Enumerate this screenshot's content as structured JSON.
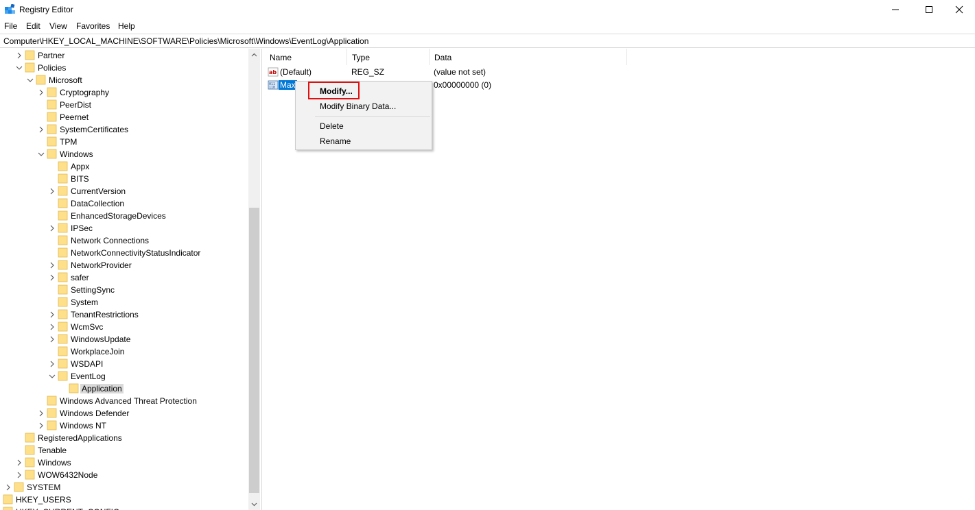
{
  "window": {
    "title": "Registry Editor",
    "minimize_glyph": "—",
    "maximize_glyph": "☐",
    "close_glyph": "✕"
  },
  "menu": [
    "File",
    "Edit",
    "View",
    "Favorites",
    "Help"
  ],
  "address": {
    "path": "Computer\\HKEY_LOCAL_MACHINE\\SOFTWARE\\Policies\\Microsoft\\Windows\\EventLog\\Application"
  },
  "tree": [
    {
      "label": "Partner",
      "expander": "collapsed"
    },
    {
      "label": "Policies",
      "expander": "expanded"
    },
    {
      "label": "Microsoft",
      "expander": "expanded"
    },
    {
      "label": "Cryptography",
      "expander": "collapsed"
    },
    {
      "label": "PeerDist",
      "expander": "none"
    },
    {
      "label": "Peernet",
      "expander": "none"
    },
    {
      "label": "SystemCertificates",
      "expander": "collapsed"
    },
    {
      "label": "TPM",
      "expander": "none"
    },
    {
      "label": "Windows",
      "expander": "expanded"
    },
    {
      "label": "Appx",
      "expander": "none"
    },
    {
      "label": "BITS",
      "expander": "none"
    },
    {
      "label": "CurrentVersion",
      "expander": "collapsed"
    },
    {
      "label": "DataCollection",
      "expander": "none"
    },
    {
      "label": "EnhancedStorageDevices",
      "expander": "none"
    },
    {
      "label": "IPSec",
      "expander": "collapsed"
    },
    {
      "label": "Network Connections",
      "expander": "none"
    },
    {
      "label": "NetworkConnectivityStatusIndicator",
      "expander": "none"
    },
    {
      "label": "NetworkProvider",
      "expander": "collapsed"
    },
    {
      "label": "safer",
      "expander": "collapsed"
    },
    {
      "label": "SettingSync",
      "expander": "none"
    },
    {
      "label": "System",
      "expander": "none"
    },
    {
      "label": "TenantRestrictions",
      "expander": "collapsed"
    },
    {
      "label": "WcmSvc",
      "expander": "collapsed"
    },
    {
      "label": "WindowsUpdate",
      "expander": "collapsed"
    },
    {
      "label": "WorkplaceJoin",
      "expander": "none"
    },
    {
      "label": "WSDAPI",
      "expander": "collapsed"
    },
    {
      "label": "EventLog",
      "expander": "expanded"
    },
    {
      "label": "Application",
      "expander": "none",
      "selected": true
    },
    {
      "label": "Windows Advanced Threat Protection",
      "expander": "none"
    },
    {
      "label": "Windows Defender",
      "expander": "collapsed"
    },
    {
      "label": "Windows NT",
      "expander": "collapsed"
    },
    {
      "label": "RegisteredApplications",
      "expander": "none"
    },
    {
      "label": "Tenable",
      "expander": "none"
    },
    {
      "label": "Windows",
      "expander": "collapsed"
    },
    {
      "label": "WOW6432Node",
      "expander": "collapsed"
    },
    {
      "label": "SYSTEM",
      "expander": "collapsed"
    },
    {
      "label": "HKEY_USERS",
      "expander": "collapsed"
    },
    {
      "label": "HKEY_CURRENT_CONFIG",
      "expander": "collapsed"
    }
  ],
  "columns": [
    "Name",
    "Type",
    "Data"
  ],
  "values": [
    {
      "name": "(Default)",
      "type": "REG_SZ",
      "data": "(value not set)",
      "icon": "string-value-icon"
    },
    {
      "name": "Max",
      "type": "",
      "data": "0x00000000 (0)",
      "icon": "dword-value-icon"
    }
  ],
  "context_menu": {
    "items": [
      "Modify...",
      "Modify Binary Data...",
      "Delete",
      "Rename"
    ]
  },
  "colors": {
    "selection_blue": "#0078d7",
    "folder_yellow": "#ffe08a",
    "highlight_red": "#e01010"
  }
}
